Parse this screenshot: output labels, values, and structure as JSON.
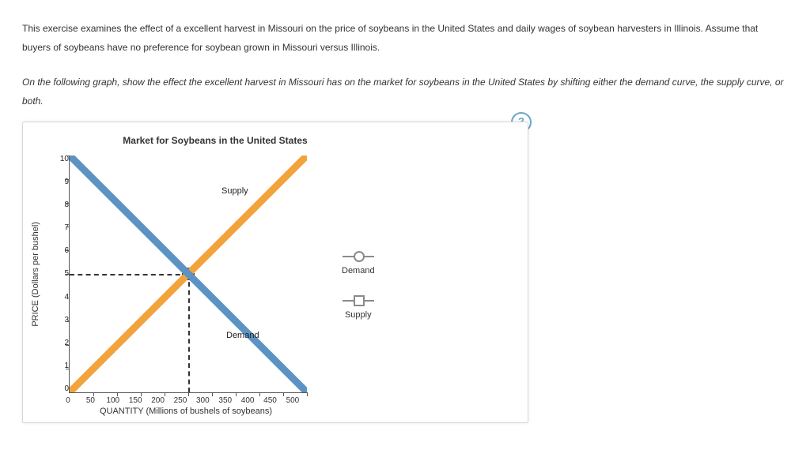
{
  "intro": "This exercise examines the effect of a excellent harvest in Missouri on the price of soybeans in the United States and daily wages of soybean harvesters in Illinois. Assume that buyers of soybeans have no preference for soybean grown in Missouri versus Illinois.",
  "instruction": "On the following graph, show the effect the excellent harvest in Missouri has on the market for soybeans in the United States by shifting either the demand curve, the supply curve, or both.",
  "help": "?",
  "chart_data": {
    "type": "line",
    "title": "Market for Soybeans in the United States",
    "xlabel": "QUANTITY (Millions of bushels of soybeans)",
    "ylabel": "PRICE (Dollars per bushel)",
    "xlim": [
      0,
      500
    ],
    "ylim": [
      0,
      10
    ],
    "x_ticks": [
      "0",
      "50",
      "100",
      "150",
      "200",
      "250",
      "300",
      "350",
      "400",
      "450",
      "500"
    ],
    "y_ticks": [
      "10",
      "9",
      "8",
      "7",
      "6",
      "5",
      "4",
      "3",
      "2",
      "1",
      "0"
    ],
    "series": [
      {
        "name": "Supply",
        "color": "#f3a33c",
        "x": [
          0,
          500
        ],
        "y": [
          0,
          10
        ]
      },
      {
        "name": "Demand",
        "color": "#5c93c4",
        "x": [
          0,
          500
        ],
        "y": [
          10,
          0
        ]
      }
    ],
    "annotations": [
      {
        "text": "Supply",
        "x": 350,
        "y": 8.5
      },
      {
        "text": "Demand",
        "x": 340,
        "y": 2.4
      }
    ],
    "equilibrium": {
      "x": 250,
      "y": 5
    }
  },
  "legend": {
    "items": [
      {
        "name": "Demand",
        "shape": "circle"
      },
      {
        "name": "Supply",
        "shape": "square"
      }
    ]
  }
}
